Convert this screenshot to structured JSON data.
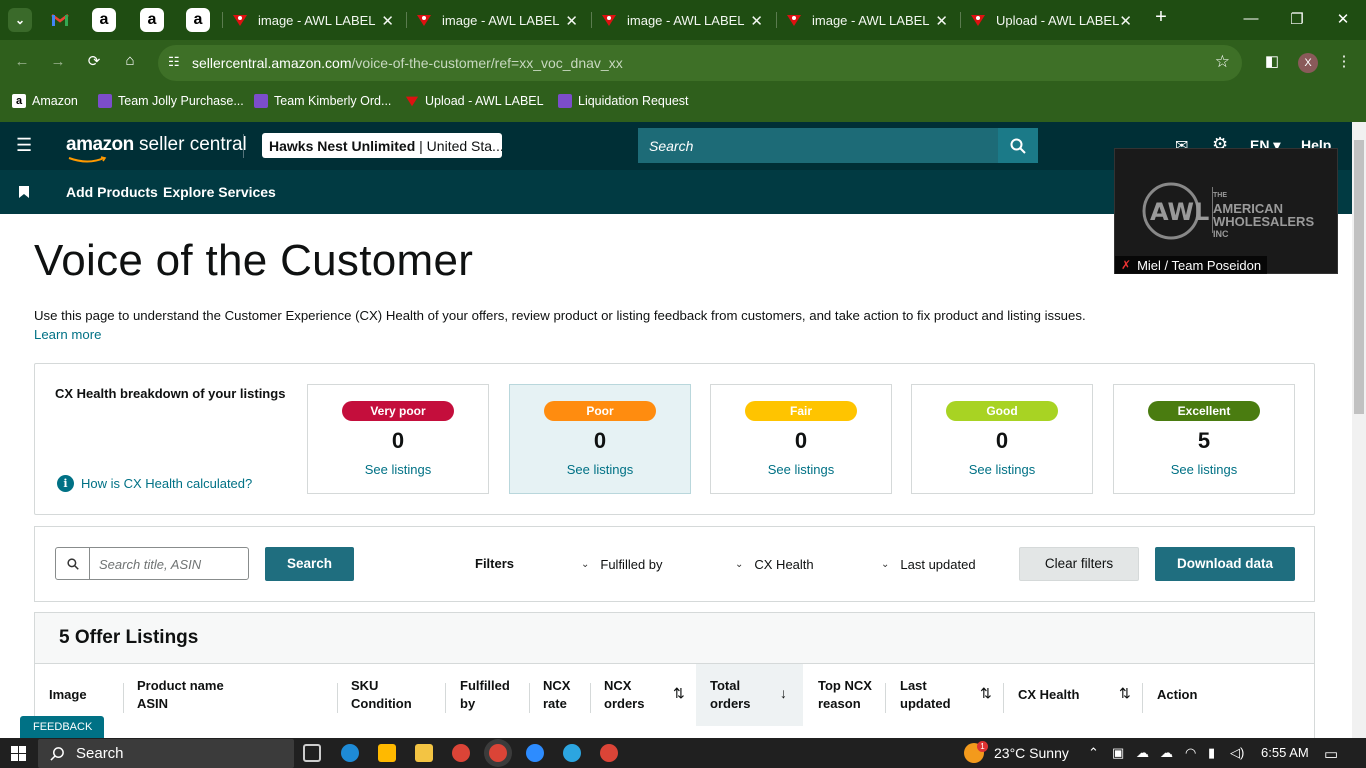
{
  "browser": {
    "tabs": [
      {
        "label": "image - AWL LABEL"
      },
      {
        "label": "image - AWL LABEL"
      },
      {
        "label": "image - AWL LABEL"
      },
      {
        "label": "image - AWL LABEL"
      },
      {
        "label": "Upload - AWL LABEL"
      }
    ],
    "url_host": "sellercentral.amazon.com",
    "url_path": "/voice-of-the-customer/ref=xx_voc_dnav_xx",
    "profile_initial": "X",
    "bookmarks": [
      {
        "label": "Amazon"
      },
      {
        "label": "Team Jolly Purchase..."
      },
      {
        "label": "Team Kimberly Ord..."
      },
      {
        "label": "Upload - AWL LABEL"
      },
      {
        "label": "Liquidation Request"
      }
    ]
  },
  "seller_central": {
    "logo_bold": "amazon",
    "logo_light": " seller central",
    "account": "Hawks Nest Unlimited",
    "account_suffix": " | United Sta...",
    "search_placeholder": "Search",
    "lang": "EN",
    "help": "Help",
    "nav": [
      "Add Products",
      "Explore Services"
    ]
  },
  "video": {
    "brand_line1": "THE",
    "brand_line2": "AMERICAN",
    "brand_line3": "WHOLESALERS",
    "brand_line4": "INC",
    "participant": "Miel / Team Poseidon"
  },
  "page": {
    "title": "Voice of the Customer",
    "description": "Use this page to understand the Customer Experience (CX) Health of your offers, review product or listing feedback from customers, and take action to fix product and listing issues.",
    "learn_more": "Learn more"
  },
  "cx_health": {
    "label": "CX Health breakdown of your listings",
    "how_link": "How is CX Health calculated?",
    "cards": [
      {
        "status": "Very poor",
        "count": "0",
        "link": "See listings",
        "color": "#c40e3c",
        "text_color": "#ffffff"
      },
      {
        "status": "Poor",
        "count": "0",
        "link": "See listings",
        "color": "#ff8c0f",
        "text_color": "#ffffff"
      },
      {
        "status": "Fair",
        "count": "0",
        "link": "See listings",
        "color": "#ffc400",
        "text_color": "#ffffff"
      },
      {
        "status": "Good",
        "count": "0",
        "link": "See listings",
        "color": "#a8d323",
        "text_color": "#ffffff"
      },
      {
        "status": "Excellent",
        "count": "5",
        "link": "See listings",
        "color": "#4a7c10",
        "text_color": "#ffffff"
      }
    ]
  },
  "filters": {
    "search_placeholder": "Search title, ASIN",
    "search_button": "Search",
    "filters_label": "Filters",
    "dropdowns": [
      "Fulfilled by",
      "CX Health",
      "Last updated"
    ],
    "clear_button": "Clear filters",
    "download_button": "Download data"
  },
  "listings": {
    "heading": "5 Offer Listings",
    "columns": [
      {
        "l1": "Image",
        "l2": ""
      },
      {
        "l1": "Product name",
        "l2": "ASIN"
      },
      {
        "l1": "SKU",
        "l2": "Condition"
      },
      {
        "l1": "Fulfilled",
        "l2": "by"
      },
      {
        "l1": "NCX",
        "l2": "rate"
      },
      {
        "l1": "NCX",
        "l2": "orders"
      },
      {
        "l1": "Total",
        "l2": "orders"
      },
      {
        "l1": "Top NCX",
        "l2": "reason"
      },
      {
        "l1": "Last",
        "l2": "updated"
      },
      {
        "l1": "CX Health",
        "l2": ""
      },
      {
        "l1": "Action",
        "l2": ""
      }
    ]
  },
  "feedback_tab": "FEEDBACK",
  "taskbar": {
    "search": "Search",
    "weather": "23°C  Sunny",
    "time": "6:55 AM",
    "weather_badge": "1"
  }
}
